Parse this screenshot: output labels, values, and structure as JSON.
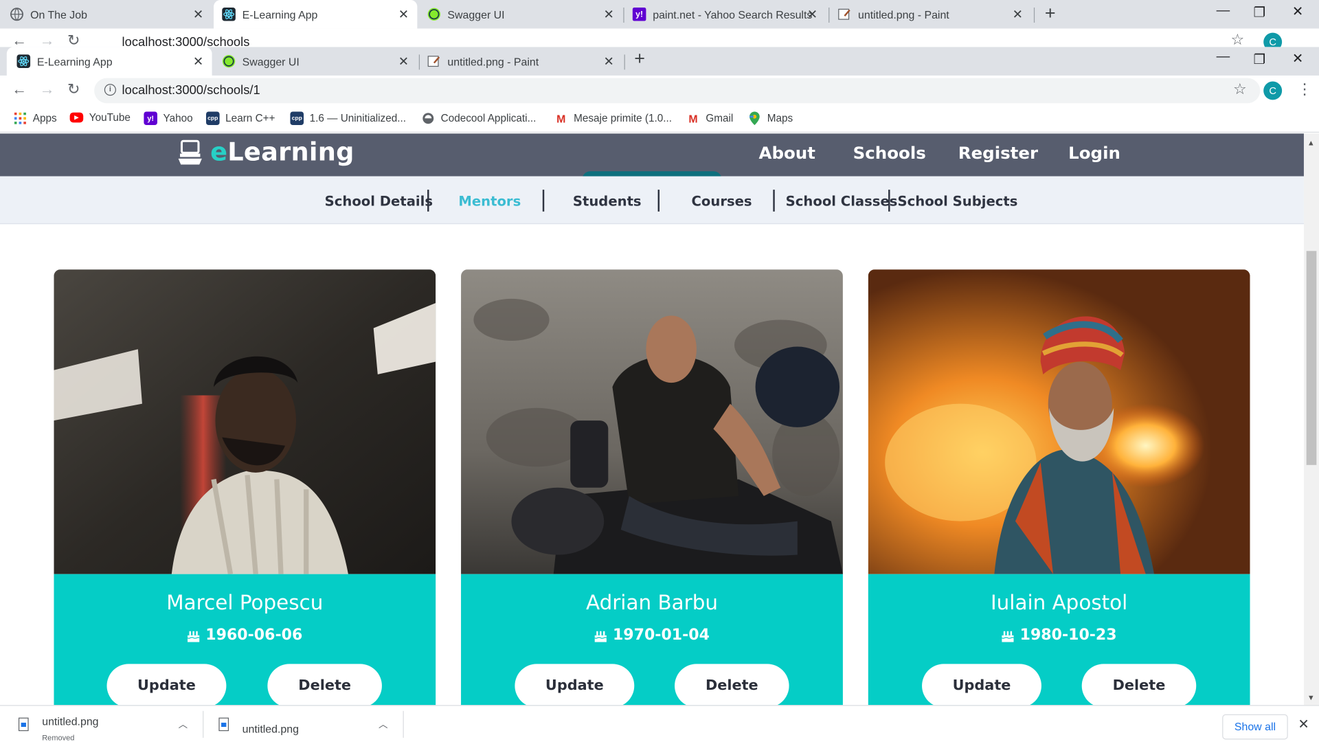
{
  "back_window": {
    "tabs": [
      {
        "title": "On The Job",
        "icon": "globe-icon"
      },
      {
        "title": "E-Learning App",
        "icon": "react-icon",
        "active": true
      },
      {
        "title": "Swagger UI",
        "icon": "swagger-icon"
      },
      {
        "title": "paint.net - Yahoo Search Results",
        "icon": "yahoo-icon"
      },
      {
        "title": "untitled.png - Paint",
        "icon": "paint-icon"
      }
    ],
    "url": "localhost:3000/schools"
  },
  "front_window": {
    "tabs": [
      {
        "title": "E-Learning App",
        "icon": "react-icon",
        "active": true
      },
      {
        "title": "Swagger UI",
        "icon": "swagger-icon"
      },
      {
        "title": "untitled.png - Paint",
        "icon": "paint-icon"
      }
    ],
    "url": "localhost:3000/schools/1",
    "profile_initial": "C",
    "bookmarks": [
      {
        "label": "Apps",
        "icon": "apps-grid-icon"
      },
      {
        "label": "YouTube",
        "icon": "youtube-icon"
      },
      {
        "label": "Yahoo",
        "icon": "yahoo-icon"
      },
      {
        "label": "Learn C++",
        "icon": "cpp-icon"
      },
      {
        "label": "1.6 — Uninitialized...",
        "icon": "cpp-icon"
      },
      {
        "label": "Codecool Applicati...",
        "icon": "codecool-icon"
      },
      {
        "label": "Mesaje primite (1.0...",
        "icon": "gmail-icon"
      },
      {
        "label": "Gmail",
        "icon": "gmail-icon"
      },
      {
        "label": "Maps",
        "icon": "maps-icon"
      }
    ]
  },
  "site": {
    "brand_accent": "e",
    "brand_rest": "Learning",
    "nav": [
      "About",
      "Schools",
      "Register",
      "Login"
    ],
    "subnav": [
      "School Details",
      "Mentors",
      "Students",
      "Courses",
      "School Classes",
      "School Subjects"
    ],
    "subnav_active": "Mentors",
    "colors": {
      "accent": "#05cdc6",
      "nav_bg": "#575d6e",
      "subnav_bg": "#edf1f7",
      "active_link": "#3bbcd2"
    }
  },
  "mentors": [
    {
      "name": "Marcel Popescu",
      "birth_date": "1960-06-06",
      "update_label": "Update",
      "delete_label": "Delete"
    },
    {
      "name": "Adrian Barbu",
      "birth_date": "1970-01-04",
      "update_label": "Update",
      "delete_label": "Delete"
    },
    {
      "name": "Iulain Apostol",
      "birth_date": "1980-10-23",
      "update_label": "Update",
      "delete_label": "Delete"
    }
  ],
  "downloads": [
    {
      "filename": "untitled.png",
      "status": "Removed"
    },
    {
      "filename": "untitled.png",
      "status": ""
    }
  ],
  "show_all_label": "Show all"
}
